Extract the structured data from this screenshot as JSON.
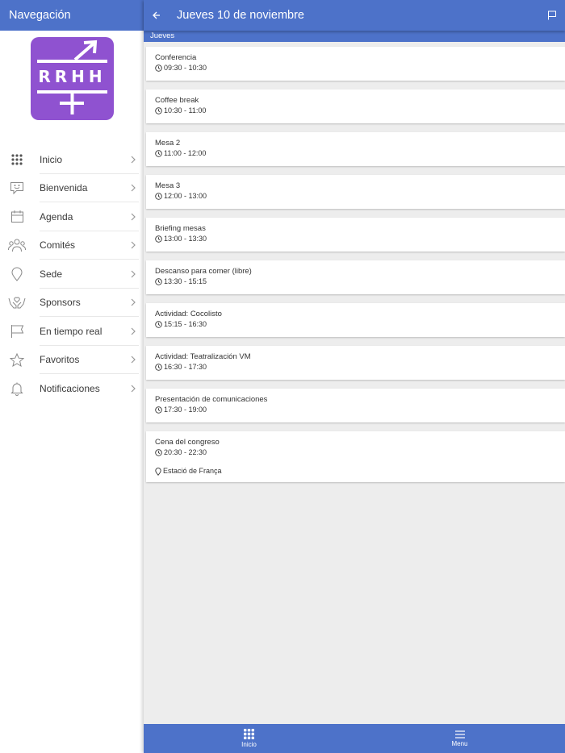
{
  "sidebar": {
    "title": "Navegación",
    "logo_text": "RRHH",
    "items": [
      {
        "label": "Inicio",
        "icon": "grid-icon"
      },
      {
        "label": "Bienvenida",
        "icon": "chat-smile-icon"
      },
      {
        "label": "Agenda",
        "icon": "calendar-icon"
      },
      {
        "label": "Comités",
        "icon": "people-icon"
      },
      {
        "label": "Sede",
        "icon": "map-pin-icon"
      },
      {
        "label": "Sponsors",
        "icon": "hands-heart-icon"
      },
      {
        "label": "En tiempo real",
        "icon": "flag-icon"
      },
      {
        "label": "Favoritos",
        "icon": "star-icon"
      },
      {
        "label": "Notificaciones",
        "icon": "bell-icon"
      }
    ]
  },
  "header": {
    "title": "Jueves 10 de noviembre",
    "back_icon": "arrow-left-icon",
    "action_icon": "flag-icon"
  },
  "day_label": "Jueves",
  "sessions": [
    {
      "title": "Conferencia",
      "time": "09:30 - 10:30"
    },
    {
      "title": "Coffee break",
      "time": "10:30 - 11:00"
    },
    {
      "title": "Mesa 2",
      "time": "11:00 - 12:00"
    },
    {
      "title": "Mesa 3",
      "time": "12:00 - 13:00"
    },
    {
      "title": "Briefing mesas",
      "time": "13:00 - 13:30"
    },
    {
      "title": "Descanso para comer (libre)",
      "time": "13:30 - 15:15"
    },
    {
      "title": "Actividad: Cocolisto",
      "time": "15:15 - 16:30"
    },
    {
      "title": "Actividad: Teatralización VM",
      "time": "16:30 - 17:30"
    },
    {
      "title": "Presentación de comunicaciones",
      "time": "17:30 - 19:00"
    },
    {
      "title": "Cena del congreso",
      "time": "20:30 - 22:30",
      "location": "Estació de França"
    }
  ],
  "bottom_nav": {
    "home_label": "Inicio",
    "menu_label": "Menu"
  },
  "colors": {
    "primary": "#4d72c9",
    "logo_bg": "#8f52d0",
    "background": "#ededed"
  }
}
